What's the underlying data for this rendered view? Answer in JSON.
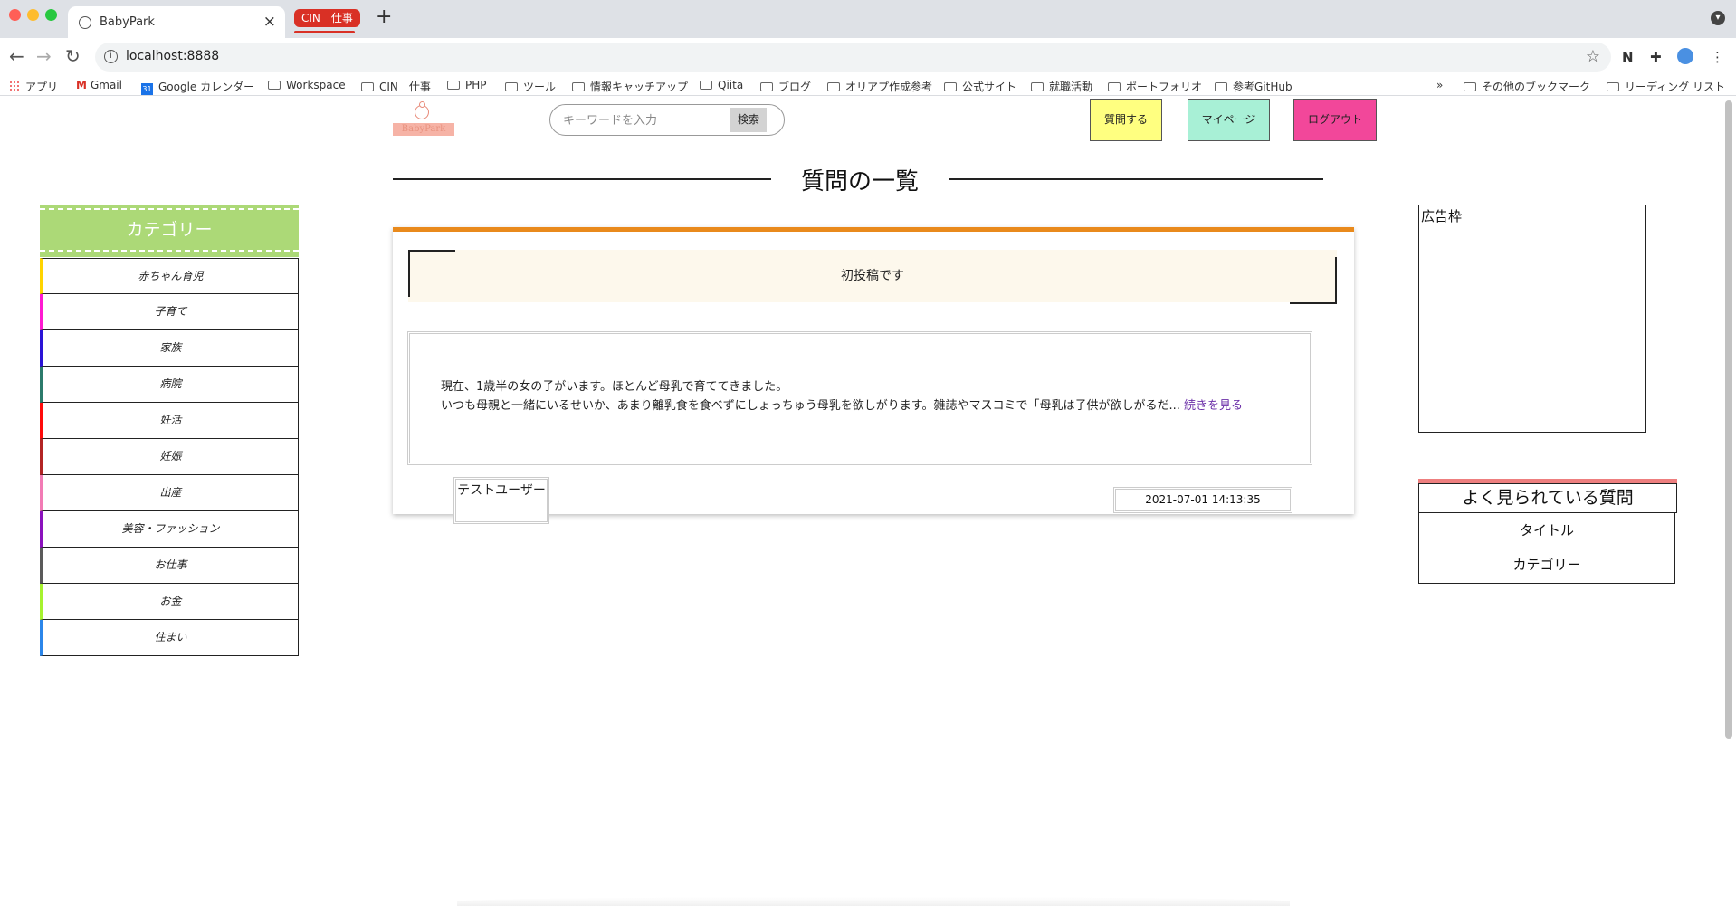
{
  "browser": {
    "tab_title": "BabyPark",
    "tab_group": "CIN　仕事",
    "url": "localhost:8888",
    "bookmarks": [
      "アプリ",
      "Gmail",
      "Google カレンダー",
      "Workspace",
      "CIN　仕事",
      "PHP",
      "ツール",
      "情報キャッチアップ",
      "Qiita",
      "ブログ",
      "オリアプ作成参考",
      "公式サイト",
      "就職活動",
      "ポートフォリオ",
      "参考GitHub"
    ],
    "overflow": "»",
    "other_bookmarks": "その他のブックマーク",
    "reading_list": "リーディング リスト"
  },
  "header": {
    "logo_text": "BabyPark",
    "search_placeholder": "キーワードを入力",
    "search_button": "検索",
    "ask_button": "質問する",
    "mypage_button": "マイページ",
    "logout_button": "ログアウト",
    "colors": {
      "ask": "#ffff80",
      "mypage": "#a8f0d6",
      "logout": "#f2479a"
    }
  },
  "page_title": "質問の一覧",
  "sidebar": {
    "title": "カテゴリー",
    "header_color": "#acd977",
    "items": [
      {
        "label": "赤ちゃん育児",
        "color": "#ffd400"
      },
      {
        "label": "子育て",
        "color": "#ff19d1"
      },
      {
        "label": "家族",
        "color": "#2a13d6"
      },
      {
        "label": "病院",
        "color": "#2b7a6b"
      },
      {
        "label": "妊活",
        "color": "#ff0a0a"
      },
      {
        "label": "妊娠",
        "color": "#b32424"
      },
      {
        "label": "出産",
        "color": "#f27bb5"
      },
      {
        "label": "美容・ファッション",
        "color": "#8b11bd"
      },
      {
        "label": "お仕事",
        "color": "#5a5a5a"
      },
      {
        "label": "お金",
        "color": "#a6f22e"
      },
      {
        "label": "住まい",
        "color": "#2b86ea"
      }
    ]
  },
  "question": {
    "title": "初投稿です",
    "body_line1": "現在、1歳半の女の子がいます。ほとんど母乳で育ててきました。",
    "body_line2": "いつも母親と一緒にいるせいか、あまり離乳食を食べずにしょっちゅう母乳を欲しがります。雑誌やマスコミで「母乳は子供が欲しがるだ...",
    "read_more": "続きを見る",
    "author": "テストユーザー",
    "date": "2021-07-01 14:13:35",
    "accent": "#e98a1c"
  },
  "right": {
    "ad_label": "広告枠",
    "popular_title": "よく見られている質問",
    "popular_rows": [
      "タイトル",
      "カテゴリー"
    ],
    "popular_accent": "#ee7f7f"
  }
}
